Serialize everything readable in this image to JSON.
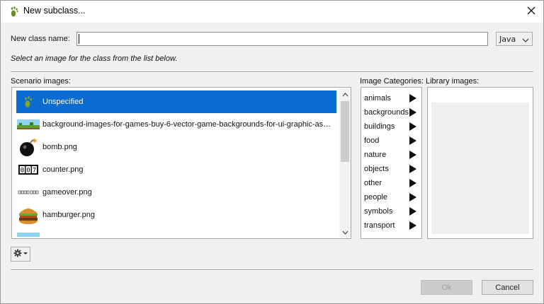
{
  "window": {
    "title": "New subclass...",
    "title_icon": "greenfoot-footprint-icon",
    "close_icon": "close-icon"
  },
  "form": {
    "class_name_label": "New class name:",
    "class_name_value": "",
    "language_value": "Java",
    "hint": "Select an image for the class from the list below."
  },
  "scenario": {
    "label": "Scenario images:",
    "items": [
      {
        "label": "Unspecified",
        "icon": "greenfoot-footprint-icon",
        "selected": true
      },
      {
        "label": "background-images-for-games-buy-6-vector-game-backgrounds-for-ui-graphic-ass...",
        "icon": "landscape-thumbnail-icon"
      },
      {
        "label": "bomb.png",
        "icon": "bomb-icon"
      },
      {
        "label": "counter.png",
        "icon": "counter-icon"
      },
      {
        "label": "gameover.png",
        "icon": "gameover-text-icon"
      },
      {
        "label": "hamburger.png",
        "icon": "hamburger-icon"
      }
    ]
  },
  "categories": {
    "label": "Image Categories:",
    "items": [
      "animals",
      "backgrounds",
      "buildings",
      "food",
      "nature",
      "objects",
      "other",
      "people",
      "symbols",
      "transport"
    ]
  },
  "library": {
    "label": "Library images:"
  },
  "buttons": {
    "ok": "Ok",
    "cancel": "Cancel",
    "gear_icon": "gear-icon"
  },
  "colors": {
    "selection": "#0a6bd1",
    "dialog_bg": "#f0f0f0"
  }
}
